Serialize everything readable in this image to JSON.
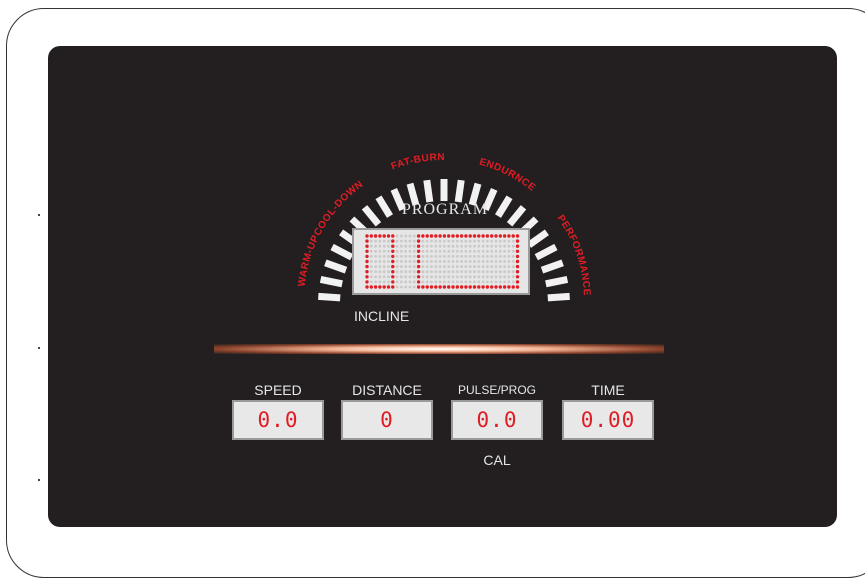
{
  "programs": {
    "warmup": "WARM-UP",
    "cooldown": "COOL-DOWN",
    "fatburn": "FAT-BURN",
    "endurance": "ENDURNCE",
    "performance": "PERFORMANCE"
  },
  "program_label": "PROGRAM",
  "incline_label": "INCLINE",
  "readouts": [
    {
      "label": "SPEED",
      "value": "0.0"
    },
    {
      "label": "DISTANCE",
      "value": "0"
    },
    {
      "label": "PULSE/PROG",
      "value": "0.0"
    },
    {
      "label": "TIME",
      "value": "0.00"
    }
  ],
  "cal_label": "CAL",
  "colors": {
    "panel": "#231f20",
    "accent_red": "#e11d24",
    "led_off": "#c9c9c9",
    "text_light": "#e6e6e6"
  }
}
